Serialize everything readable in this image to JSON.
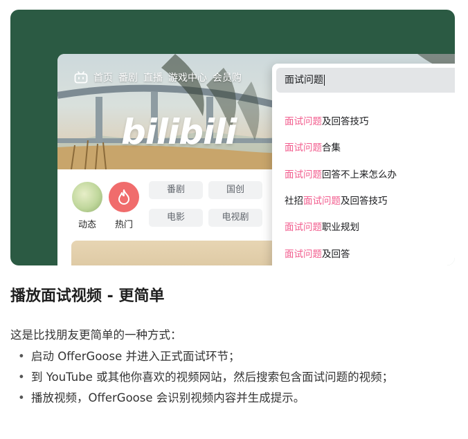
{
  "nav": {
    "items": [
      "首页",
      "番剧",
      "直播",
      "游戏中心",
      "会员购"
    ]
  },
  "brand": {
    "logo_text": "bilibili"
  },
  "quick": {
    "dynamic_label": "动态",
    "hot_label": "热门"
  },
  "chips": [
    "番剧",
    "国创",
    "电影",
    "电视剧"
  ],
  "search": {
    "value": "面试问题",
    "suggestions": [
      {
        "prefix": "",
        "highlight": "面试问题",
        "suffix": "及回答技巧"
      },
      {
        "prefix": "",
        "highlight": "面试问题",
        "suffix": "合集"
      },
      {
        "prefix": "",
        "highlight": "面试问题",
        "suffix": "回答不上来怎么办"
      },
      {
        "prefix": "社招",
        "highlight": "面试问题",
        "suffix": "及回答技巧"
      },
      {
        "prefix": "",
        "highlight": "面试问题",
        "suffix": "职业规划"
      },
      {
        "prefix": "",
        "highlight": "面试问题",
        "suffix": "及回答"
      }
    ]
  },
  "content": {
    "heading": "播放面试视频 - 更简单",
    "intro": "这是比找朋友更简单的一种方式：",
    "bullets": [
      "启动 OfferGoose 并进入正式面试环节；",
      "到 YouTube 或其他你喜欢的视频网站，然后搜索包含面试问题的视频；",
      "播放视频，OfferGoose 会识别视频内容并生成提示。"
    ]
  },
  "colors": {
    "hero_bg": "#2b5a43",
    "highlight": "#f25d8e",
    "hot_icon_bg": "#f06c6c"
  }
}
